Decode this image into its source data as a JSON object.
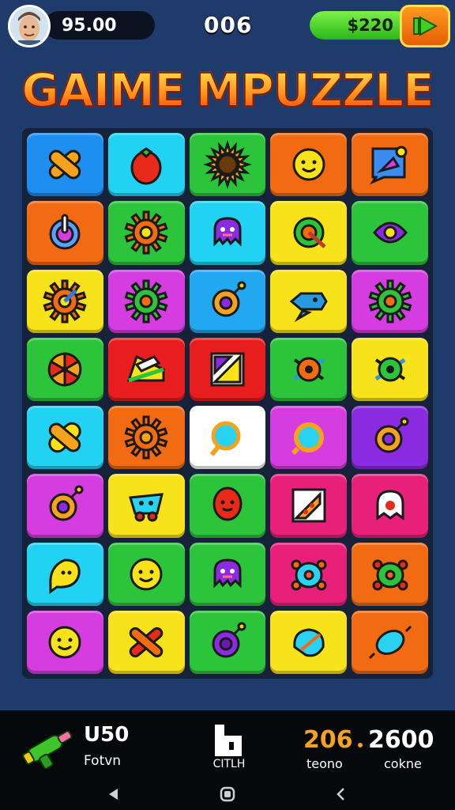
{
  "hud": {
    "score": "95.00",
    "level": "006",
    "money": "$220",
    "icons": {
      "avatar": "player-avatar",
      "play": "play-arrow-icon"
    }
  },
  "title": {
    "word1": "GAIME",
    "word2": "MPUZZLE"
  },
  "board": {
    "rows": 8,
    "cols": 5,
    "tiles": [
      {
        "color": "#1e8ef0",
        "icon": "bandage-icon"
      },
      {
        "color": "#22d2f2",
        "icon": "tomato-icon"
      },
      {
        "color": "#2cc43a",
        "icon": "sunflower-icon"
      },
      {
        "color": "#f26a12",
        "icon": "smiley-face-icon"
      },
      {
        "color": "#f26a12",
        "icon": "picture-tag-icon"
      },
      {
        "color": "#f26a12",
        "icon": "power-button-icon"
      },
      {
        "color": "#2cc43a",
        "icon": "gear-sun-icon"
      },
      {
        "color": "#22d2f2",
        "icon": "purple-ghost-icon"
      },
      {
        "color": "#f8e21a",
        "icon": "target-orb-icon"
      },
      {
        "color": "#2cc43a",
        "icon": "purple-bug-icon"
      },
      {
        "color": "#f8e21a",
        "icon": "gear-wrench-icon"
      },
      {
        "color": "#d63de0",
        "icon": "green-gear-icon"
      },
      {
        "color": "#22a8f0",
        "icon": "ring-key-icon"
      },
      {
        "color": "#f8e21a",
        "icon": "blue-fish-icon"
      },
      {
        "color": "#d63de0",
        "icon": "green-gear-icon"
      },
      {
        "color": "#2cc43a",
        "icon": "pinwheel-icon"
      },
      {
        "color": "#e81d1d",
        "icon": "cheese-wedge-icon"
      },
      {
        "color": "#e81d1d",
        "icon": "picture-frame-icon"
      },
      {
        "color": "#2cc43a",
        "icon": "orange-bug-icon"
      },
      {
        "color": "#f8e21a",
        "icon": "green-bug-icon"
      },
      {
        "color": "#22d2f2",
        "icon": "yellow-candy-icon"
      },
      {
        "color": "#f26a12",
        "icon": "orange-gear-icon"
      },
      {
        "color": "#ffffff",
        "icon": "magnifier-icon"
      },
      {
        "color": "#d63de0",
        "icon": "orange-ring-icon"
      },
      {
        "color": "#8a2be2",
        "icon": "key-ring-icon"
      },
      {
        "color": "#d63de0",
        "icon": "ring-key-icon"
      },
      {
        "color": "#f8e21a",
        "icon": "blue-monster-icon"
      },
      {
        "color": "#2cc43a",
        "icon": "red-balloon-icon"
      },
      {
        "color": "#e8207a",
        "icon": "pizza-card-icon"
      },
      {
        "color": "#e8207a",
        "icon": "white-ghost-icon"
      },
      {
        "color": "#22d2f2",
        "icon": "lemon-icon"
      },
      {
        "color": "#2cc43a",
        "icon": "smiley-face-icon"
      },
      {
        "color": "#2cc43a",
        "icon": "purple-ghost-icon"
      },
      {
        "color": "#e8207a",
        "icon": "blue-turtle-icon"
      },
      {
        "color": "#f26a12",
        "icon": "green-turtle-icon"
      },
      {
        "color": "#d63de0",
        "icon": "smiley-face-icon"
      },
      {
        "color": "#f8e21a",
        "icon": "crossed-sticks-icon"
      },
      {
        "color": "#2cc43a",
        "icon": "purple-orb-icon"
      },
      {
        "color": "#f8e21a",
        "icon": "blue-orb-icon"
      },
      {
        "color": "#f26a12",
        "icon": "blue-candy-icon"
      }
    ]
  },
  "footer": {
    "powerup_count": "U50",
    "powerup_label": "Fotvn",
    "middle_label": "CITLH",
    "stat1_value": "206",
    "stat1_label": "teono",
    "stat2_value": "2600",
    "stat2_label": "cokne",
    "nav": {
      "back": "◀",
      "home": "home",
      "recent": "❮"
    }
  }
}
